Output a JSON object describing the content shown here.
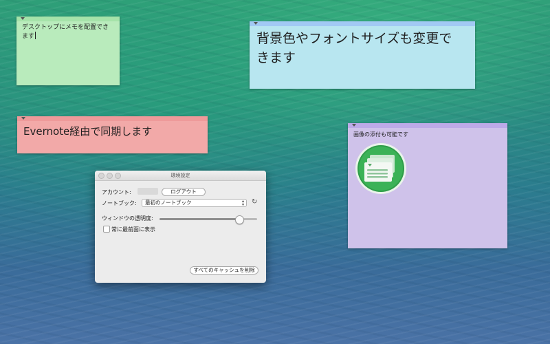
{
  "notes": {
    "green": {
      "text": "デスクトップにメモを配置できます",
      "color": "#b9ebbc"
    },
    "blue": {
      "line1": "背景色やフォントサイズも変更で",
      "line2": "きます",
      "color": "#b8e6f0"
    },
    "red": {
      "text": "Evernote経由で同期します",
      "color": "#f2a9a8"
    },
    "purple": {
      "text": "画像の添付も可能です",
      "color": "#cfc2ea",
      "image_icon": "stacked-notes-app-icon"
    }
  },
  "preferences": {
    "title": "環境設定",
    "account_label": "アカウント:",
    "logout_button": "ログアウト",
    "notebook_label": "ノートブック:",
    "notebook_selected": "最初のノートブック",
    "refresh_icon": "refresh-icon",
    "opacity_label": "ウィンドウの透明度:",
    "opacity_value": 0.82,
    "always_on_top_label": "常に最前面に表示",
    "always_on_top_checked": false,
    "clear_cache_button": "すべてのキャッシュを削除"
  }
}
